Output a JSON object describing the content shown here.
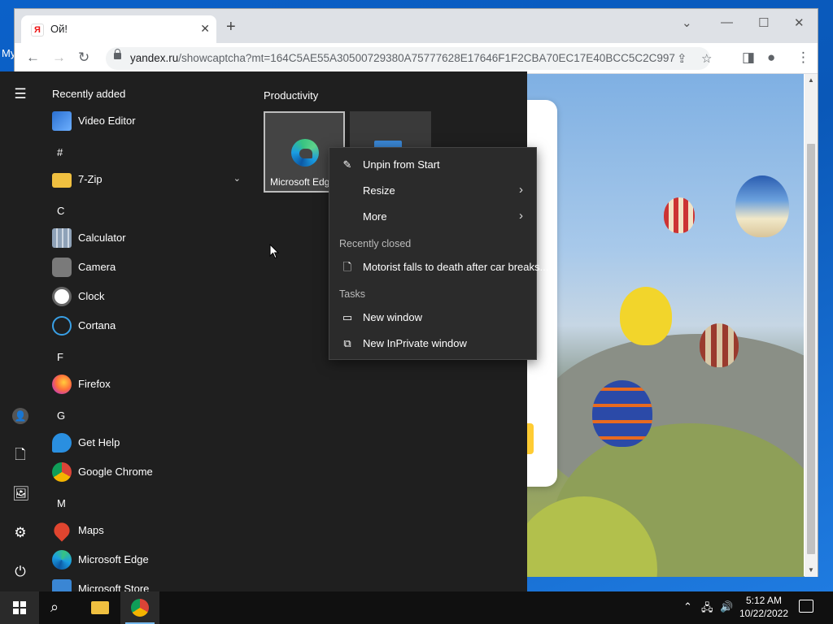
{
  "desktop": {
    "label": "My"
  },
  "browser": {
    "tab_title": "Ой!",
    "tab_favicon": "Я",
    "url_host": "yandex.ru",
    "url_path": "/showcaptcha?mt=164C5AE55A30500729380A75777628E17646F1F2CBA70EC17E40BCC5C2C997...",
    "icons": [
      "back-icon",
      "forward-icon",
      "reload-icon",
      "share-icon",
      "star-icon",
      "sidebar-icon",
      "profile-icon",
      "kebab-menu-icon"
    ]
  },
  "start_menu": {
    "recently_added": "Recently added",
    "apps": [
      {
        "label": "Video Editor",
        "icon": "video-editor-icon"
      },
      {
        "letter": "#"
      },
      {
        "label": "7-Zip",
        "icon": "folder-icon"
      },
      {
        "letter": "C"
      },
      {
        "label": "Calculator",
        "icon": "calculator-icon"
      },
      {
        "label": "Camera",
        "icon": "camera-icon"
      },
      {
        "label": "Clock",
        "icon": "clock-icon"
      },
      {
        "label": "Cortana",
        "icon": "cortana-icon"
      },
      {
        "letter": "F"
      },
      {
        "label": "Firefox",
        "icon": "firefox-icon"
      },
      {
        "letter": "G"
      },
      {
        "label": "Get Help",
        "icon": "get-help-icon"
      },
      {
        "label": "Google Chrome",
        "icon": "chrome-icon"
      },
      {
        "letter": "M"
      },
      {
        "label": "Maps",
        "icon": "maps-icon"
      },
      {
        "label": "Microsoft Edge",
        "icon": "edge-icon"
      },
      {
        "label": "Microsoft Store",
        "icon": "store-icon"
      }
    ],
    "tiles_group": "Productivity",
    "tile_edge": "Microsoft Edge"
  },
  "context_menu": {
    "unpin": "Unpin from Start",
    "resize": "Resize",
    "more": "More",
    "recently_closed_header": "Recently closed",
    "recent_item": "Motorist falls to death after car breaks...",
    "tasks_header": "Tasks",
    "new_window": "New window",
    "new_inprivate": "New InPrivate window"
  },
  "taskbar": {
    "time": "5:12 AM",
    "date": "10/22/2022"
  },
  "colors": {
    "start_bg": "#1f1f1f",
    "context_bg": "#2b2b2b",
    "taskbar_bg": "#101010",
    "desktop_blue": "#0b61c9"
  }
}
